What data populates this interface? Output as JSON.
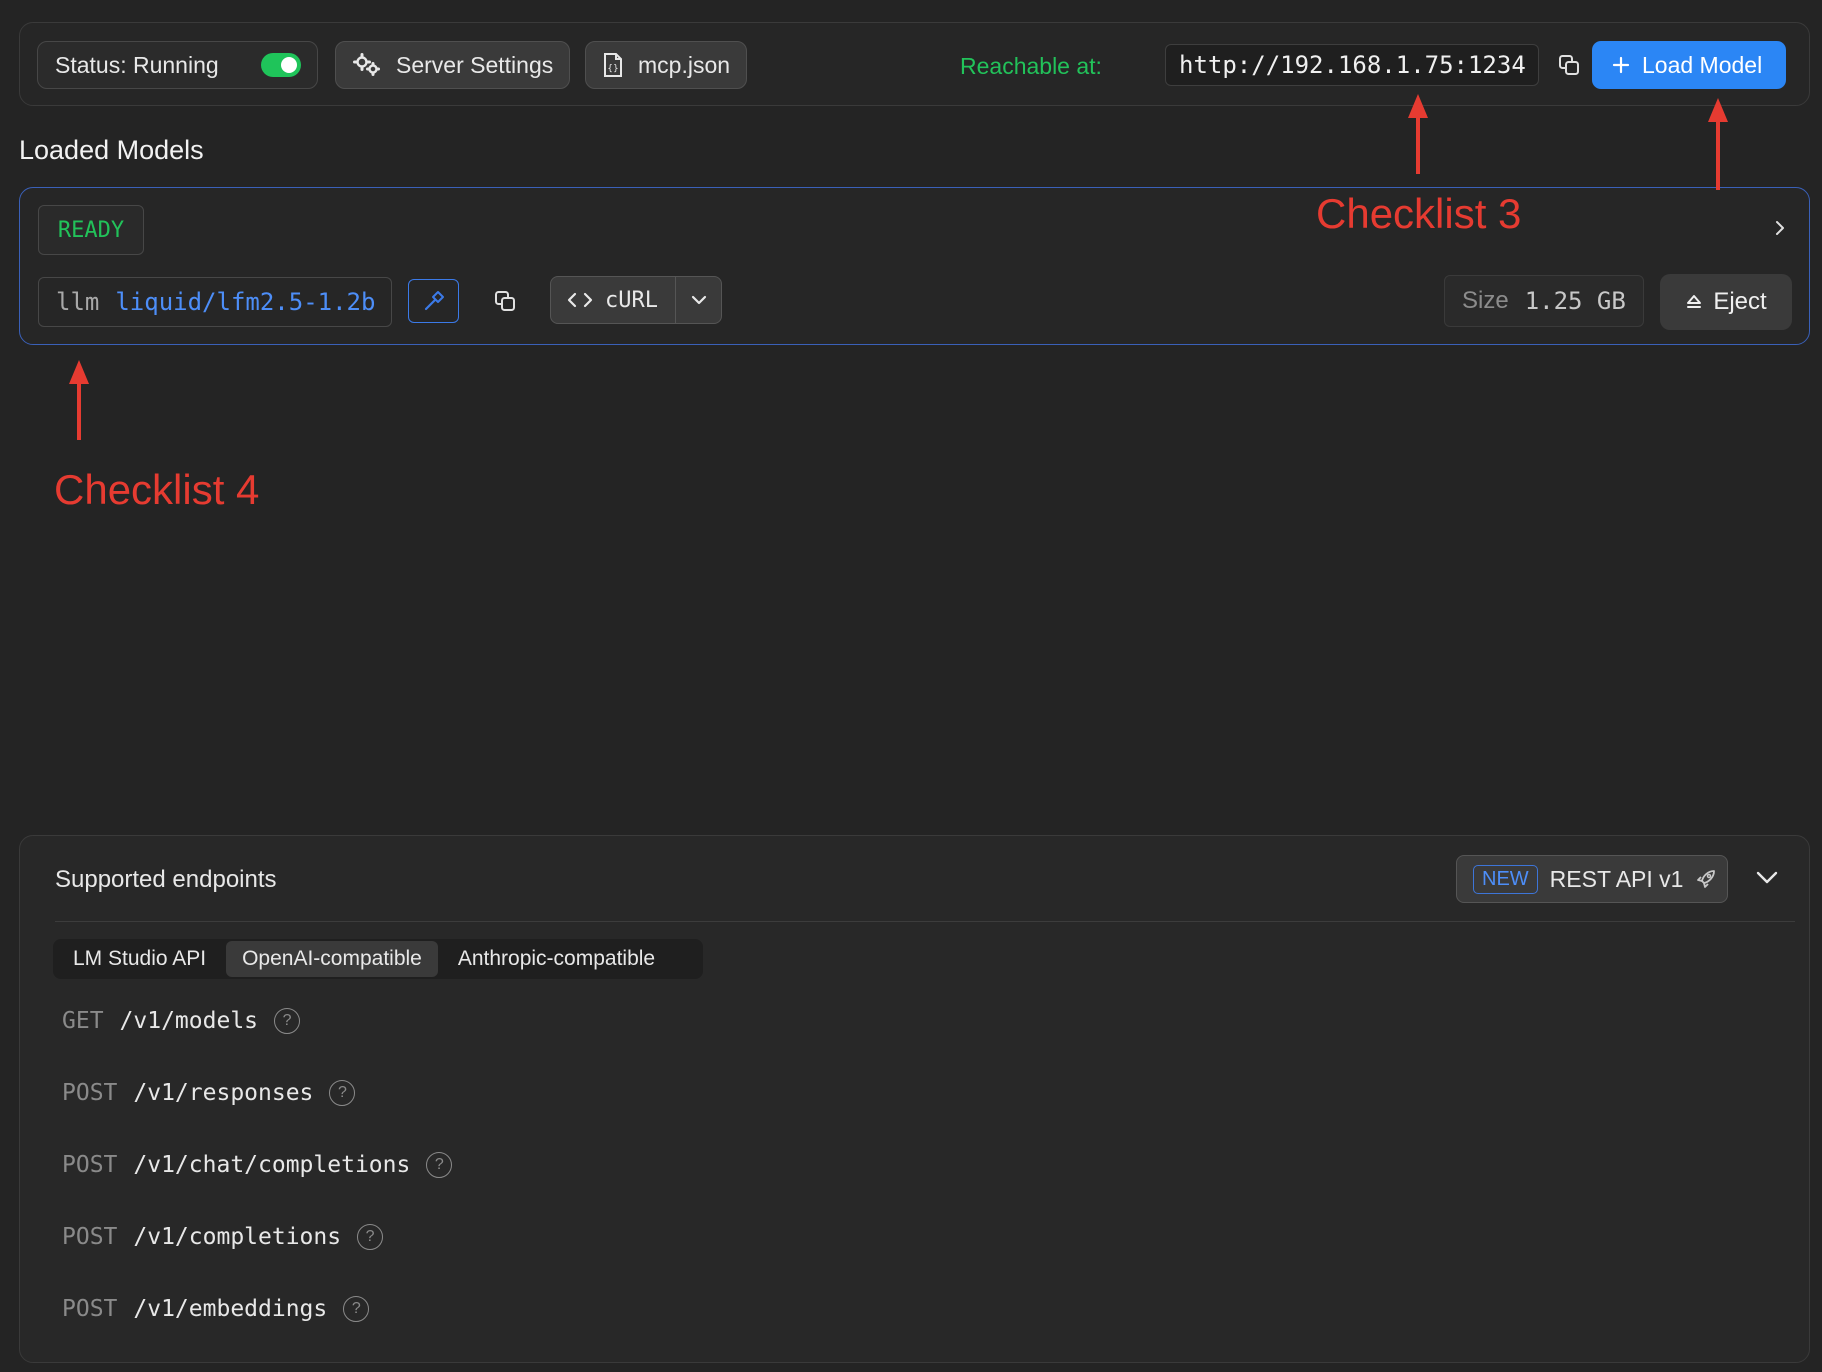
{
  "topbar": {
    "status_label": "Status: Running",
    "server_settings": "Server Settings",
    "mcp_json": "mcp.json",
    "reachable_label": "Reachable at:",
    "url": "http://192.168.1.75:1234",
    "load_model": "Load Model"
  },
  "loaded_models": {
    "title": "Loaded Models",
    "model": {
      "status": "READY",
      "type": "llm",
      "name": "liquid/lfm2.5-1.2b",
      "curl_label": "cURL",
      "size_label": "Size",
      "size_value": "1.25 GB",
      "eject_label": "Eject"
    }
  },
  "annotations": {
    "checklist3": "Checklist 3",
    "checklist4": "Checklist 4"
  },
  "endpoints": {
    "title": "Supported endpoints",
    "new_badge": "NEW",
    "rest_label": "REST API v1",
    "tabs": [
      "LM Studio API",
      "OpenAI-compatible",
      "Anthropic-compatible"
    ],
    "active_tab": "OpenAI-compatible",
    "list": [
      {
        "method": "GET",
        "path": "/v1/models"
      },
      {
        "method": "POST",
        "path": "/v1/responses"
      },
      {
        "method": "POST",
        "path": "/v1/chat/completions"
      },
      {
        "method": "POST",
        "path": "/v1/completions"
      },
      {
        "method": "POST",
        "path": "/v1/embeddings"
      }
    ]
  },
  "colors": {
    "accent_blue": "#2b86f5",
    "status_green": "#22c25a",
    "annotation_red": "#e63b31",
    "background": "#242424"
  }
}
